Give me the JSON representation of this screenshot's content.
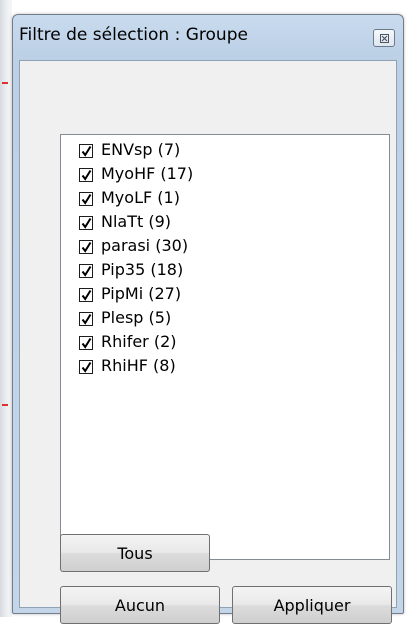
{
  "window": {
    "title": "Filtre de sélection : Groupe"
  },
  "list": {
    "items": [
      {
        "label": "ENVsp (7)",
        "checked": true
      },
      {
        "label": "MyoHF (17)",
        "checked": true
      },
      {
        "label": "MyoLF (1)",
        "checked": true
      },
      {
        "label": "NlaTt (9)",
        "checked": true
      },
      {
        "label": "parasi (30)",
        "checked": true
      },
      {
        "label": "Pip35 (18)",
        "checked": true
      },
      {
        "label": "PipMi (27)",
        "checked": true
      },
      {
        "label": "Plesp (5)",
        "checked": true
      },
      {
        "label": "Rhifer (2)",
        "checked": true
      },
      {
        "label": "RhiHF (8)",
        "checked": true
      }
    ]
  },
  "buttons": {
    "all_label": "Tous",
    "none_label": "Aucun",
    "apply_label": "Appliquer"
  },
  "icons": {
    "close": "close-icon",
    "checkmark": "checkmark-icon"
  }
}
